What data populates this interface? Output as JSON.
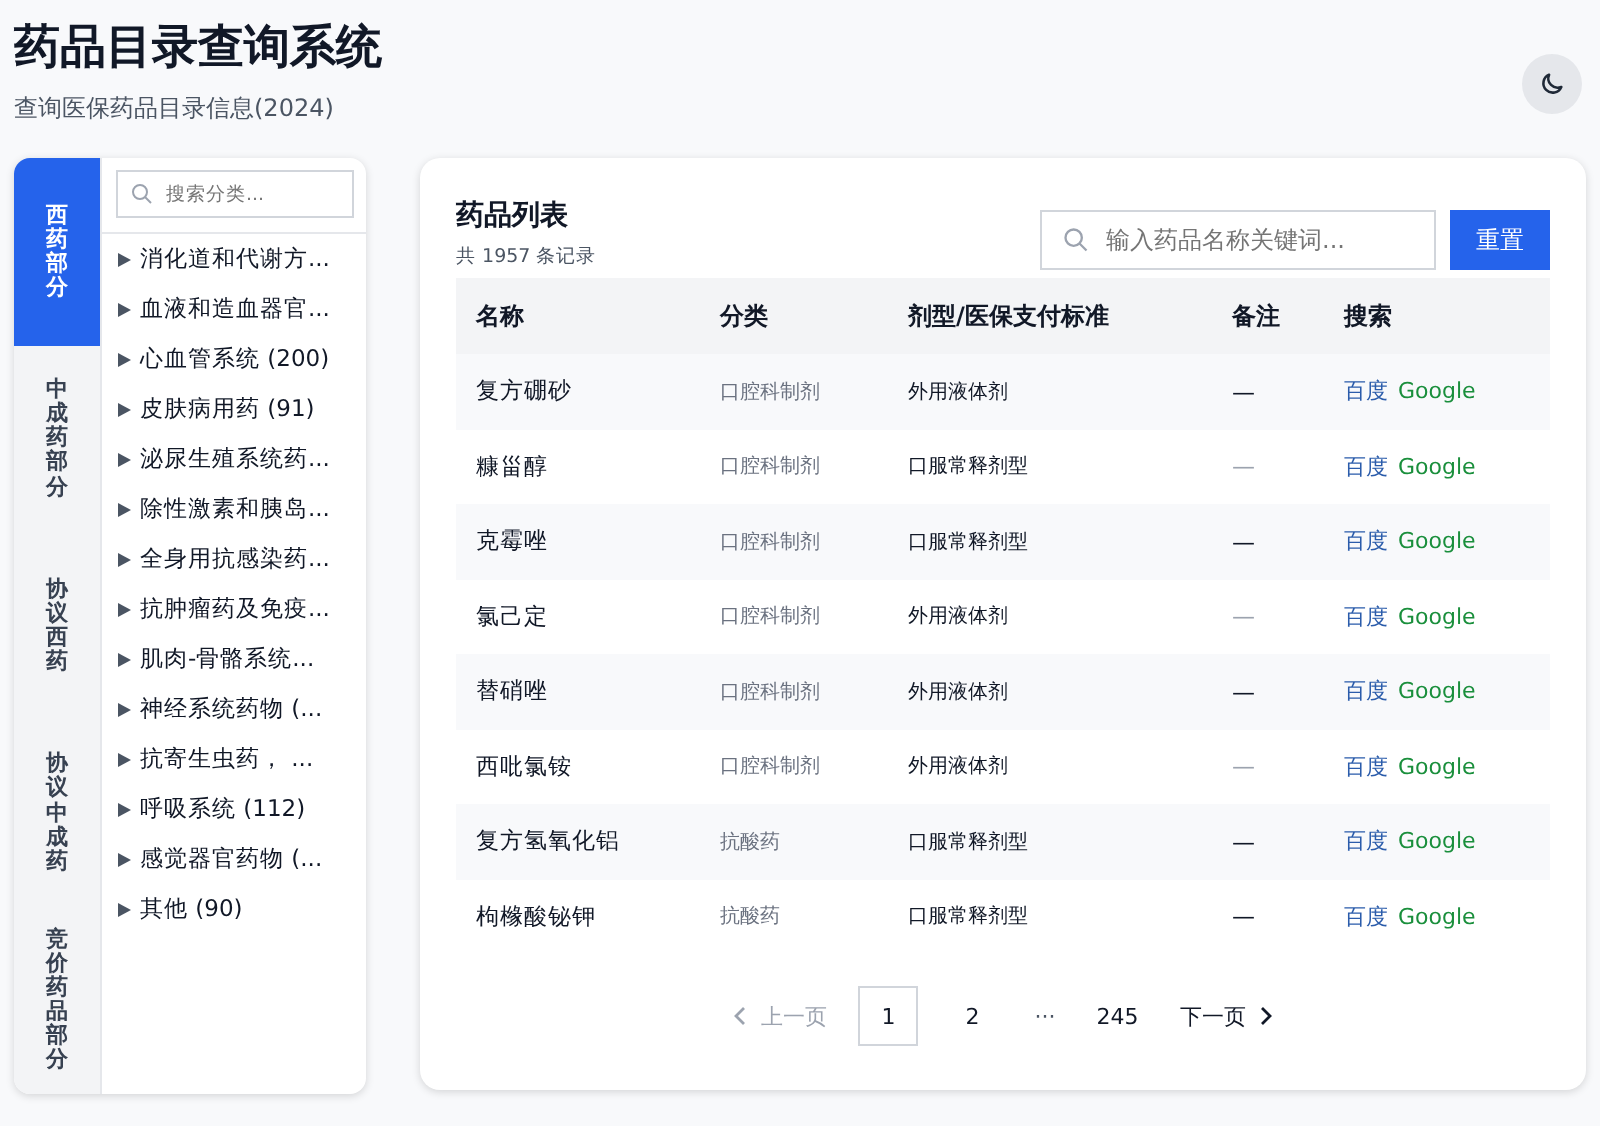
{
  "header": {
    "title": "药品目录查询系统",
    "subtitle": "查询医保药品目录信息(2024)"
  },
  "section_tabs": [
    {
      "label": "西药部分",
      "selected": true
    },
    {
      "label": "中成药部分",
      "selected": false
    },
    {
      "label": "协议西药",
      "selected": false
    },
    {
      "label": "协议中成药",
      "selected": false
    },
    {
      "label": "竞价药品部分",
      "selected": false
    }
  ],
  "category_search": {
    "placeholder": "搜索分类..."
  },
  "categories": [
    {
      "label": "消化道和代谢方...",
      "expanded": false
    },
    {
      "label": "血液和造血器官...",
      "expanded": false
    },
    {
      "label": "心血管系统 (200)",
      "expanded": false
    },
    {
      "label": "皮肤病用药 (91)",
      "expanded": false
    },
    {
      "label": "泌尿生殖系统药...",
      "expanded": false
    },
    {
      "label": "除性激素和胰岛...",
      "expanded": false
    },
    {
      "label": "全身用抗感染药...",
      "expanded": false
    },
    {
      "label": "抗肿瘤药及免疫...",
      "expanded": false
    },
    {
      "label": "肌肉-骨骼系统...",
      "expanded": false
    },
    {
      "label": "神经系统药物 (...",
      "expanded": false
    },
    {
      "label": "抗寄生虫药， ...",
      "expanded": false
    },
    {
      "label": "呼吸系统 (112)",
      "expanded": false
    },
    {
      "label": "感觉器官药物 (...",
      "expanded": false
    },
    {
      "label": "其他 (90)",
      "expanded": false
    }
  ],
  "list": {
    "title": "药品列表",
    "count": "共 1957 条记录",
    "search": {
      "placeholder": "输入药品名称关键词..."
    },
    "reset_button": "重置"
  },
  "table": {
    "columns": [
      "名称",
      "分类",
      "剂型/医保支付标准",
      "备注",
      "搜索"
    ],
    "rows": [
      {
        "name": "复方硼砂",
        "category": "口腔科制剂",
        "form": "外用液体剂",
        "note": "—",
        "note_dim": false,
        "links": [
          "百度",
          "Google"
        ]
      },
      {
        "name": "糠甾醇",
        "category": "口腔科制剂",
        "form": "口服常释剂型",
        "note": "—",
        "note_dim": true,
        "links": [
          "百度",
          "Google"
        ]
      },
      {
        "name": "克霉唑",
        "category": "口腔科制剂",
        "form": "口服常释剂型",
        "note": "—",
        "note_dim": false,
        "links": [
          "百度",
          "Google"
        ]
      },
      {
        "name": "氯己定",
        "category": "口腔科制剂",
        "form": "外用液体剂",
        "note": "—",
        "note_dim": true,
        "links": [
          "百度",
          "Google"
        ]
      },
      {
        "name": "替硝唑",
        "category": "口腔科制剂",
        "form": "外用液体剂",
        "note": "—",
        "note_dim": false,
        "links": [
          "百度",
          "Google"
        ]
      },
      {
        "name": "西吡氯铵",
        "category": "口腔科制剂",
        "form": "外用液体剂",
        "note": "—",
        "note_dim": true,
        "links": [
          "百度",
          "Google"
        ]
      },
      {
        "name": "复方氢氧化铝",
        "category": "抗酸药",
        "form": "口服常释剂型",
        "note": "—",
        "note_dim": false,
        "links": [
          "百度",
          "Google"
        ]
      },
      {
        "name": "枸橼酸铋钾",
        "category": "抗酸药",
        "form": "口服常释剂型",
        "note": "—",
        "note_dim": false,
        "links": [
          "百度",
          "Google"
        ]
      }
    ]
  },
  "pagination": {
    "prev": {
      "label": "上一页",
      "disabled": true
    },
    "pages": [
      {
        "label": "1",
        "kind": "page",
        "selected": true
      },
      {
        "label": "2",
        "kind": "page",
        "selected": false
      },
      {
        "label": "···",
        "kind": "ellipsis"
      },
      {
        "label": "245",
        "kind": "page",
        "selected": false
      }
    ],
    "next": {
      "label": "下一页",
      "disabled": false
    }
  }
}
